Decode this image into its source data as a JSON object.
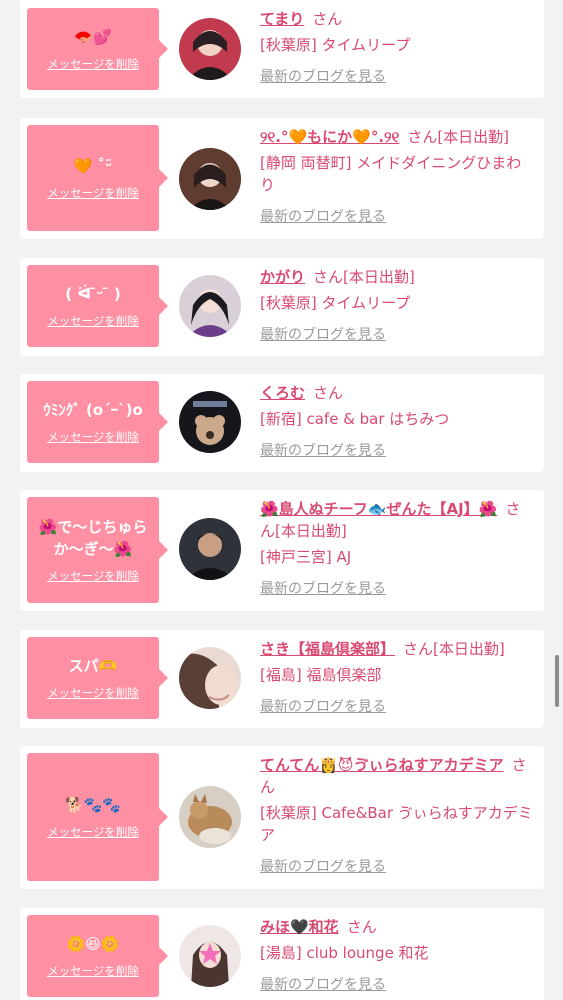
{
  "colors": {
    "bubble": "#ff8fa3",
    "accent_text": "#d94a72",
    "link_gray": "#9a9a9a",
    "page_background": "#f2f2f2"
  },
  "labels": {
    "delete_message": "メッセージを削除",
    "latest_blog": "最新のブログを見る"
  },
  "entries": [
    {
      "message": "🪭💕",
      "cast_name": "てまり",
      "suffix": "さん",
      "shop": "[秋葉原] タイムリープ"
    },
    {
      "message": "🧡 ˚ᵕ̈",
      "cast_name": "୨୧.°🧡もにか🧡°.୨୧",
      "suffix": "さん[本日出勤]",
      "shop": "[静岡 両替町] メイドダイニングひまわり"
    },
    {
      "message": "( ᐛ ̄ᵕ ̄ )",
      "cast_name": "かがり",
      "suffix": "さん[本日出勤]",
      "shop": "[秋葉原] タイムリープ"
    },
    {
      "message": "ｳﾐﾝｸﾞ (o´ｰ`)o",
      "cast_name": "くろむ",
      "suffix": "さん",
      "shop": "[新宿] cafe & bar はちみつ"
    },
    {
      "message": "🌺で〜じちゅらか〜ぎ〜🌺",
      "cast_name": "🌺島人ぬチーフ🐟ぜんた【AJ】🌺",
      "suffix": "さん[本日出勤]",
      "shop": "[神戸三宮] AJ"
    },
    {
      "message": "スパ🫶",
      "cast_name": "さき【福島倶楽部】",
      "suffix": "さん[本日出勤]",
      "shop": "[福島] 福島倶楽部"
    },
    {
      "message": "🐕🐾🐾",
      "cast_name": "てんてん👸😈ゔぃらねすアカデミア",
      "suffix": "さん",
      "shop": "[秋葉原] Cafe&Bar ゔぃらねすアカデミア"
    },
    {
      "message": "🌼😆🌼",
      "cast_name": "みほ🖤和花",
      "suffix": "さん",
      "shop": "[湯島] club lounge 和花"
    }
  ]
}
